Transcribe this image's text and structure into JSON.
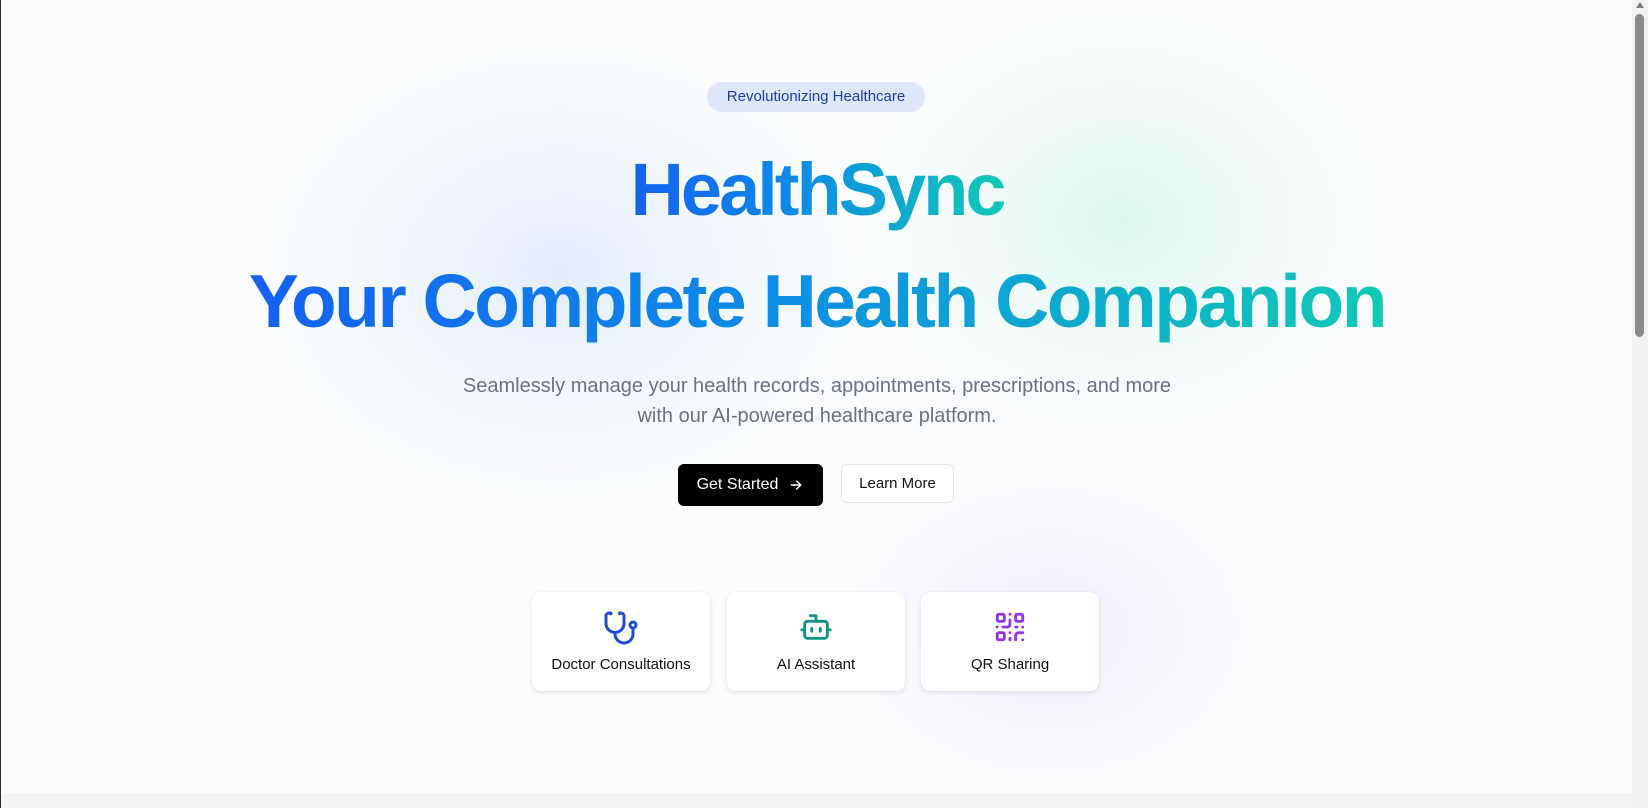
{
  "hero": {
    "badge": "Revolutionizing Healthcare",
    "brand": "HealthSync",
    "headline": "Your Complete Health Companion",
    "subtitle_line1": "Seamlessly manage your health records, appointments, prescriptions, and more",
    "subtitle_line2": "with our AI-powered healthcare platform."
  },
  "actions": {
    "primary_label": "Get Started",
    "primary_icon": "arrow-right-icon",
    "secondary_label": "Learn More"
  },
  "features": [
    {
      "label": "Doctor Consultations",
      "icon": "stethoscope-icon",
      "color": "#1d4ed8"
    },
    {
      "label": "AI Assistant",
      "icon": "bot-icon",
      "color": "#0d9488"
    },
    {
      "label": "QR Sharing",
      "icon": "qr-code-icon",
      "color": "#9333ea"
    }
  ],
  "colors": {
    "gradient_start": "#1560f0",
    "gradient_end": "#10c9b5",
    "badge_bg": "#dde7fb",
    "badge_text": "#1d3fa5",
    "primary_button": "#000000"
  }
}
